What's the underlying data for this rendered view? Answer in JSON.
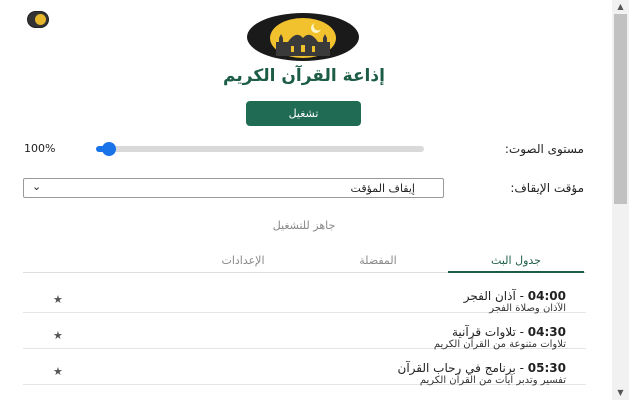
{
  "header": {
    "title": "إذاعة القرآن الكريم",
    "logo_icon": "mosque-moon-icon",
    "theme_icon": "theme-toggle-icon"
  },
  "player": {
    "play_label": "تشغيل",
    "status": "جاهز للتشغيل"
  },
  "volume": {
    "label": "مستوى الصوت:",
    "value_text": "100%",
    "level": 0.04
  },
  "sleep_timer": {
    "label": "مؤقت الإيقاف:",
    "selected": "إيقاف المؤقت"
  },
  "tabs": [
    {
      "label": "جدول البث",
      "active": true
    },
    {
      "label": "المفضلة",
      "active": false
    },
    {
      "label": "الإعدادات",
      "active": false
    }
  ],
  "schedule": [
    {
      "time": "04:00",
      "title": "آذان الفجر",
      "desc": "الآذان وصلاة الفجر"
    },
    {
      "time": "04:30",
      "title": "تلاوات قرآنية",
      "desc": "تلاوات متنوعة من القرآن الكريم"
    },
    {
      "time": "05:30",
      "title": "برنامج في رحاب القرآن",
      "desc": "تفسير وتدبر آيات من القرآن الكريم"
    }
  ],
  "colors": {
    "accent": "#1f6b53",
    "title": "#1d5d46",
    "slider": "#1a73e8"
  }
}
